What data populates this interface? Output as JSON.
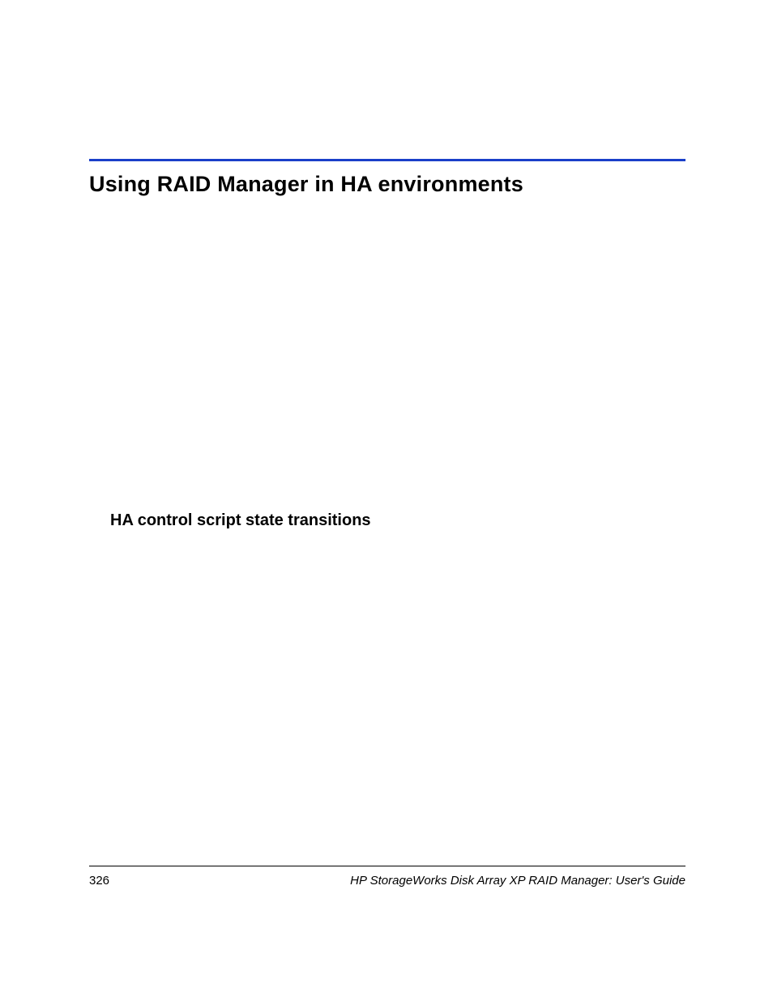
{
  "headings": {
    "main": "Using RAID Manager in HA environments",
    "sub": "HA control script state transitions"
  },
  "footer": {
    "page_number": "326",
    "title": "HP StorageWorks Disk Array XP RAID Manager: User's Guide"
  }
}
